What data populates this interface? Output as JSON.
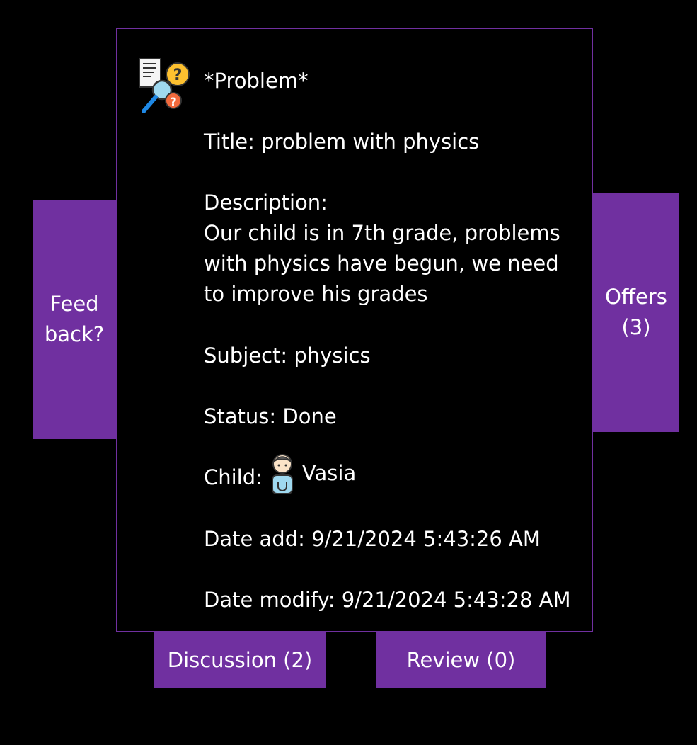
{
  "card": {
    "heading": "*Problem*",
    "title_line": "Title: problem with physics",
    "description_label": "Description:",
    "description_text": "Our child is in 7th grade, problems with physics have begun, we need to improve his grades",
    "subject_line": "Subject: physics",
    "status_line": "Status: Done",
    "child_label": "Child:",
    "child_name": "Vasia",
    "date_add_line": "Date add: 9/21/2024 5:43:26 AM",
    "date_modify_line": "Date modify: 9/21/2024 5:43:28 AM",
    "icon": "problem-search-icon"
  },
  "buttons": {
    "feedback_line1": "Feed",
    "feedback_line2": "back?",
    "offers_line1": "Offers",
    "offers_line2": "(3)",
    "discussion": "Discussion (2)",
    "review": "Review (0)"
  },
  "colors": {
    "accent": "#7030a0",
    "background": "#000000",
    "text": "#ffffff"
  }
}
